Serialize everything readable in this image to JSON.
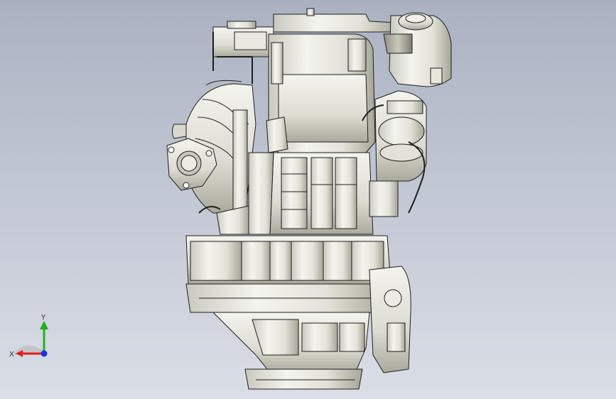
{
  "viewport": {
    "background_top": "#aab2c2",
    "background_bottom": "#dadee6"
  },
  "model": {
    "fill_light": "#f2f2ec",
    "fill_mid": "#dcdcd2",
    "fill_dark": "#a9a99c",
    "edge": "#1e1e1e"
  },
  "triad": {
    "x_label": "X",
    "y_label": "Y",
    "x_color": "#e02020",
    "y_color": "#20b020",
    "z_color": "#2030e0"
  }
}
